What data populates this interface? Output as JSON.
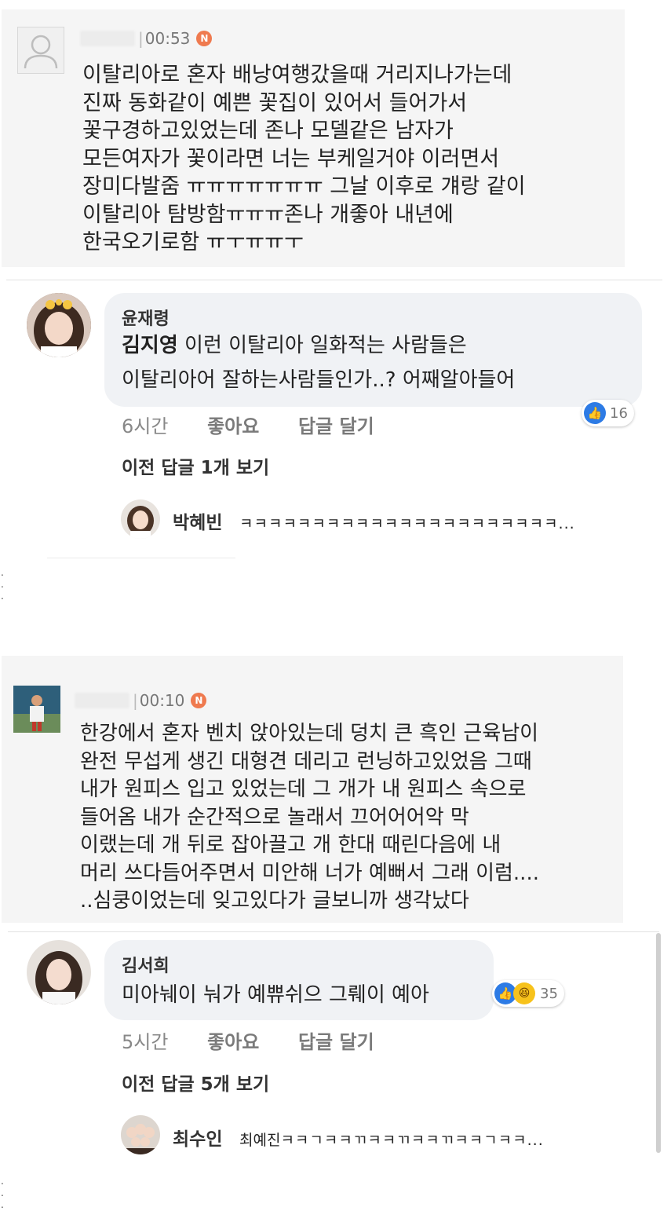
{
  "post1": {
    "time": "00:53",
    "badge": "N",
    "lines": [
      "이탈리아로 혼자 배낭여행갔을때 거리지나가는데",
      "진짜 동화같이 예쁜 꽃집이 있어서 들어가서",
      "꽃구경하고있었는데 존나 모델같은 남자가",
      "모든여자가 꽃이라면 너는 부케일거야 이러면서",
      "장미다발줌 ㅠㅠㅠㅠㅠㅠㅠ 그날 이후로 걔랑 같이",
      "이탈리아 탐방함ㅠㅠㅠ존나 개좋아 내년에",
      "한국오기로함 ㅠㅜㅠㅠㅜ"
    ]
  },
  "comment1": {
    "author": "윤재령",
    "mention": "김지영",
    "line1": " 이런 이탈리아 일화적는 사람들은",
    "line2": "이탈리아어 잘하는사람들인가..? 어째알아들어",
    "time": "6시간",
    "like": "좋아요",
    "reply": "답글 달기",
    "reaction_count": "16",
    "prev_replies": "이전 답글 1개 보기",
    "reply_author": "박혜빈",
    "reply_text": "ㅋㅋㅋㅋㅋㅋㅋㅋㅋㅋㅋㅋㅋㅋㅋㅋㅋㅋㅋㅋㅋㅋ..."
  },
  "post2": {
    "time": "00:10",
    "badge": "N",
    "lines": [
      "한강에서 혼자 벤치 앉아있는데 덩치 큰 흑인 근육남이",
      "완전 무섭게 생긴 대형견 데리고 런닝하고있었음 그때",
      "내가 원피스 입고 있었는데 그 개가 내 원피스 속으로",
      "들어옴 내가 순간적으로 놀래서 끄어어어악 막",
      "이랬는데 개 뒤로 잡아끌고 개 한대 때린다음에 내",
      "머리 쓰다듬어주면서 미안해 너가 예뻐서 그래 이럼....",
      "..심쿵이었는데 잊고있다가 글보니까 생각났다"
    ]
  },
  "comment2": {
    "author": "김서희",
    "text": "미아눼이 눠가 예쀼쉬으 그뤠이 예아",
    "time": "5시간",
    "like": "좋아요",
    "reply": "답글 달기",
    "reaction_count": "35",
    "prev_replies": "이전 답글 5개 보기",
    "reply_author": "최수인",
    "reply_mention": "최예진",
    "reply_text": "ㅋㅋㄱㅋㅋㄲㅋㅋㄲㅋㅋㄲㅋㅋㄱㅋㅋ..."
  },
  "colors": {
    "post_bg": "#f5f5f5",
    "bubble_bg": "#f0f2f5",
    "badge": "#ef7a4f",
    "like_blue": "#2d7be5"
  }
}
